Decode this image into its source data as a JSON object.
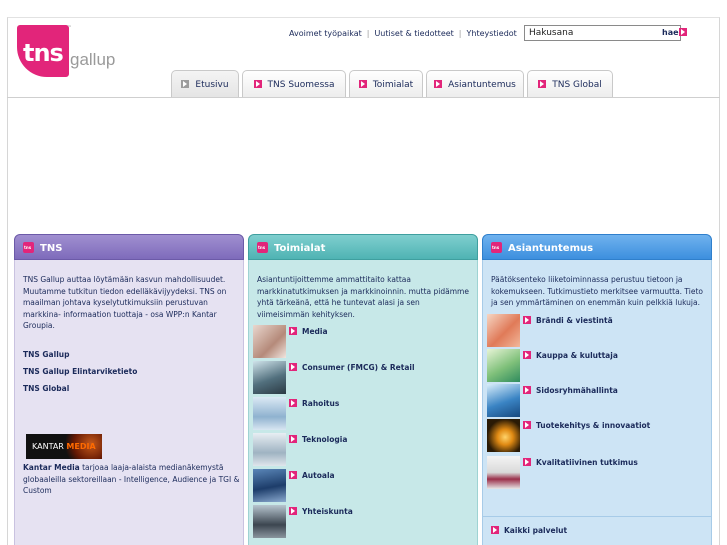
{
  "logo": {
    "tns": "tns",
    "gallup": "gallup"
  },
  "toplinks": [
    "Avoimet työpaikat",
    "Uutiset & tiedotteet",
    "Yhteystiedot"
  ],
  "search": {
    "value": "Hakusana",
    "button": "hae"
  },
  "tabs": [
    "Etusivu",
    "TNS Suomessa",
    "Toimialat",
    "Asiantuntemus",
    "TNS Global"
  ],
  "col1": {
    "title": "TNS",
    "intro": "TNS Gallup auttaa löytämään kasvun mahdollisuudet. Muutamme tutkitun tiedon edelläkävijyydeksi. TNS on maailman johtava kyselytutkimuksiin perustuvan markkina- informaation tuottaja - osa WPP:n Kantar Groupia.",
    "links": [
      "TNS Gallup",
      "TNS Gallup Elintarviketieto",
      "TNS Global"
    ],
    "kantar_logo": {
      "kantar": "KANTAR",
      "media": "MEDIA"
    },
    "kantar_bold": "Kantar Media",
    "kantar_text": " tarjoaa laaja-alaista medianäkemystä globaaleilla sektoreillaan - Intelligence, Audience ja TGI & Custom"
  },
  "col2": {
    "title": "Toimialat",
    "intro": "Asiantuntijoittemme ammattitaito kattaa markkinatutkimuksen ja markkinoinnin. mutta pidämme yhtä tärkeänä, että he tuntevat alasi ja sen viimeisimmän kehityksen.",
    "items": [
      "Media",
      "Consumer (FMCG) & Retail",
      "Rahoitus",
      "Teknologia",
      "Autoala",
      "Yhteiskunta"
    ]
  },
  "col3": {
    "title": "Asiantuntemus",
    "intro": "Päätöksenteko liiketoiminnassa perustuu tietoon ja kokemukseen. Tutkimustieto merkitsee varmuutta. Tieto ja sen ymmärtäminen on enemmän kuin pelkkiä lukuja.",
    "items": [
      "Brändi & viestintä",
      "Kauppa & kuluttaja",
      "Sidosryhmähallinta",
      "Tuotekehitys & innovaatiot",
      "Kvalitatiivinen tutkimus"
    ],
    "all": "Kaikki palvelut"
  }
}
